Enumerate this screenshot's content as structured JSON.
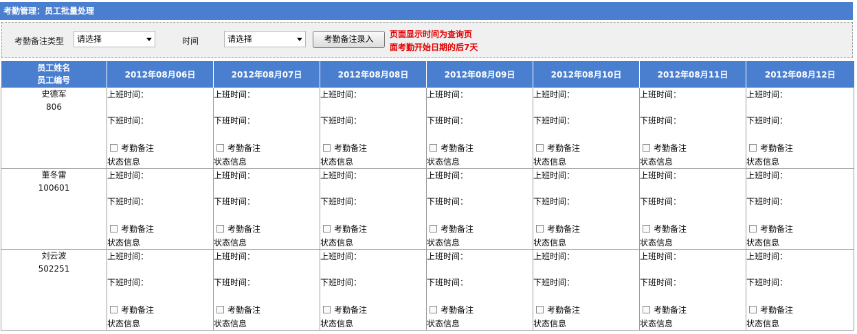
{
  "title": "考勤管理：员工批量处理",
  "filter": {
    "type_label": "考勤备注类型",
    "type_value": "请选择",
    "time_label": "时间",
    "time_value": "请选择",
    "submit_label": "考勤备注录入",
    "note_line1": "页面显示时间为查询页",
    "note_line2": "面考勤开始日期的后7天"
  },
  "header": {
    "name_line1": "员工姓名",
    "name_line2": "员工编号",
    "dates": [
      "2012年08月06日",
      "2012年08月07日",
      "2012年08月08日",
      "2012年08月09日",
      "2012年08月10日",
      "2012年08月11日",
      "2012年08月12日"
    ]
  },
  "cell_labels": {
    "on_duty": "上班时间：",
    "off_duty": "下班时间：",
    "memo": "考勤备注",
    "status": "状态信息"
  },
  "employees": [
    {
      "name": "史德军",
      "id": "806"
    },
    {
      "name": "董冬雷",
      "id": "100601"
    },
    {
      "name": "刘云波",
      "id": "502251"
    }
  ],
  "colors": {
    "header_blue": "#4a7fd0",
    "note_red": "#e00000"
  }
}
